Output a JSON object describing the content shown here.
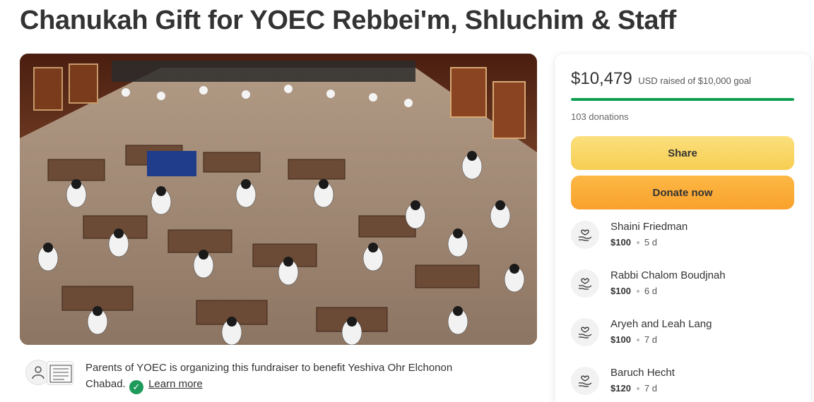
{
  "page": {
    "title": "Chanukah Gift for YOEC Rebbei'm, Shluchim & Staff"
  },
  "organizer": {
    "text_before": "Parents of YOEC is organizing this fundraiser to benefit Yeshiva Ohr Elchonon Chabad.",
    "verified_icon": "check-circle-icon",
    "learn_more_label": "Learn more"
  },
  "sidebar": {
    "amount_raised": "$10,479",
    "goal_text": "USD raised of $10,000 goal",
    "progress_fraction": 1.0,
    "donations_count": "103 donations",
    "share_label": "Share",
    "donate_label": "Donate now",
    "accent_color": "#0d9f4f",
    "donors": [
      {
        "name": "Shaini Friedman",
        "amount": "$100",
        "time": "5 d",
        "icon": "donation-heart-hand-icon"
      },
      {
        "name": "Rabbi Chalom Boudjnah",
        "amount": "$100",
        "time": "6 d",
        "icon": "donation-heart-hand-icon"
      },
      {
        "name": "Aryeh and Leah Lang",
        "amount": "$100",
        "time": "7 d",
        "icon": "donation-heart-hand-icon"
      },
      {
        "name": "Baruch Hecht",
        "amount": "$120",
        "time": "7 d",
        "icon": "donation-heart-hand-icon"
      }
    ]
  }
}
